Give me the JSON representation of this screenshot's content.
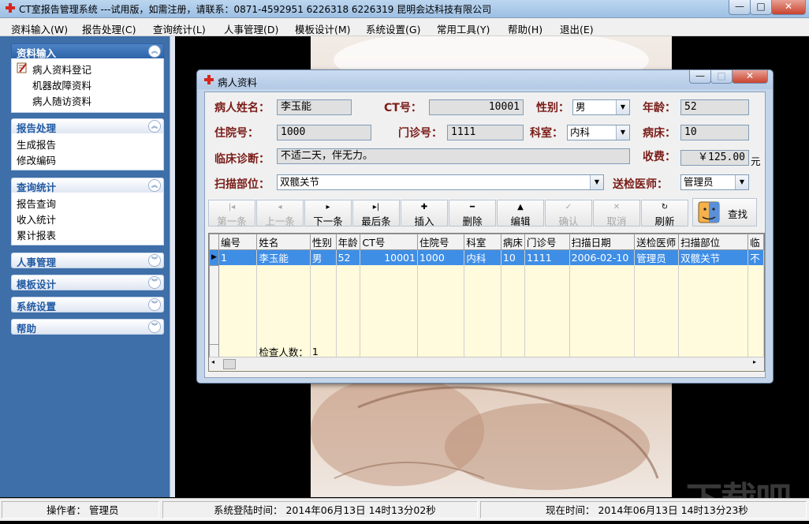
{
  "window": {
    "title": "CT室报告管理系统   ---试用版，如需注册，请联系：0871-4592951 6226318 6226319 昆明会达科技有限公司"
  },
  "menubar": [
    "资料输入(W)",
    "报告处理(C)",
    "查询统计(L)",
    "人事管理(D)",
    "模板设计(M)",
    "系统设置(G)",
    "常用工具(Y)",
    "帮助(H)",
    "退出(E)"
  ],
  "sidebar": {
    "groups": [
      {
        "title": "资料输入",
        "items": [
          "病人资料登记",
          "机器故障资料",
          "病人随访资料"
        ]
      },
      {
        "title": "报告处理",
        "items": [
          "生成报告",
          "修改编码"
        ]
      },
      {
        "title": "查询统计",
        "items": [
          "报告查询",
          "收入统计",
          "累计报表"
        ]
      },
      {
        "title": "人事管理",
        "items": []
      },
      {
        "title": "模板设计",
        "items": []
      },
      {
        "title": "系统设置",
        "items": []
      },
      {
        "title": "帮助",
        "items": []
      }
    ]
  },
  "dialog": {
    "title": "病人资料",
    "fields": {
      "name_label": "病人姓名：",
      "name_value": "李玉能",
      "ct_label": "CT号：",
      "ct_value": "10001",
      "gender_label": "性别：",
      "gender_value": "男",
      "age_label": "年龄：",
      "age_value": "52",
      "inpatient_label": "住院号：",
      "inpatient_value": "1000",
      "outpatient_label": "门诊号：",
      "outpatient_value": "1111",
      "dept_label": "科室：",
      "dept_value": "内科",
      "bed_label": "病床：",
      "bed_value": "10",
      "diagnosis_label": "临床诊断：",
      "diagnosis_value": "不适二天，伴无力。",
      "fee_label": "收费：",
      "fee_value": "￥125.00",
      "fee_unit": "元",
      "scan_label": "扫描部位：",
      "scan_value": "双髋关节",
      "doctor_label": "送检医师：",
      "doctor_value": "管理员"
    },
    "toolbar": [
      {
        "label": "第一条",
        "icon": "|◂",
        "enabled": false
      },
      {
        "label": "上一条",
        "icon": "◂",
        "enabled": false
      },
      {
        "label": "下一条",
        "icon": "▸",
        "enabled": true
      },
      {
        "label": "最后条",
        "icon": "▸|",
        "enabled": true
      },
      {
        "label": "插入",
        "icon": "✚",
        "enabled": true
      },
      {
        "label": "删除",
        "icon": "━",
        "enabled": true
      },
      {
        "label": "编辑",
        "icon": "▲",
        "enabled": true
      },
      {
        "label": "确认",
        "icon": "✓",
        "enabled": false
      },
      {
        "label": "取消",
        "icon": "✕",
        "enabled": false
      },
      {
        "label": "刷新",
        "icon": "↻",
        "enabled": true
      }
    ],
    "search_label": "查找",
    "grid": {
      "columns": [
        "编号",
        "姓名",
        "性别",
        "年龄",
        "CT号",
        "住院号",
        "科室",
        "病床",
        "门诊号",
        "扫描日期",
        "送检医师",
        "扫描部位",
        "临"
      ],
      "rows": [
        [
          "1",
          "李玉能",
          "男",
          "52",
          "10001",
          "1000",
          "内科",
          "10",
          "1111",
          "2006-02-10",
          "管理员",
          "双髋关节",
          "不"
        ]
      ],
      "footer_label": "检查人数：",
      "footer_value": "1"
    }
  },
  "statusbar": {
    "operator": "操作者：   管理员",
    "login_time": "系统登陆时间：  2014年06月13日    14时13分02秒",
    "current_time": "现在时间：  2014年06月13日    14时13分23秒"
  },
  "watermark": "下载吧",
  "colors": {
    "label": "#7a1c17",
    "selection": "#3f8ee6",
    "grid_bg": "#fffbdc",
    "sidebar_bg": "#3e6fa8"
  }
}
